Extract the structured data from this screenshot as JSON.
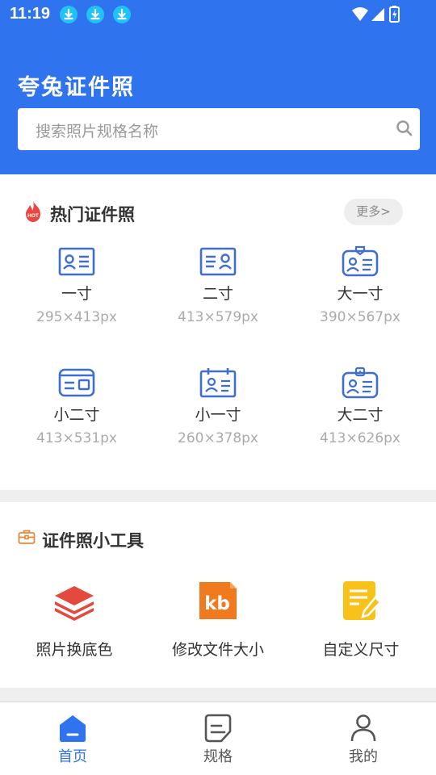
{
  "status_bar": {
    "time": "11:19"
  },
  "header": {
    "title": "夸兔证件照",
    "search_placeholder": "搜索照片规格名称"
  },
  "hot_section": {
    "badge": "HOT",
    "title": "热门证件照",
    "more_label": "更多>",
    "items": [
      {
        "name": "一寸",
        "size": "295×413px"
      },
      {
        "name": "二寸",
        "size": "413×579px"
      },
      {
        "name": "大一寸",
        "size": "390×567px"
      },
      {
        "name": "小二寸",
        "size": "413×531px"
      },
      {
        "name": "小一寸",
        "size": "260×378px"
      },
      {
        "name": "大二寸",
        "size": "413×626px"
      }
    ]
  },
  "tools_section": {
    "title": "证件照小工具",
    "items": [
      {
        "name": "照片换底色",
        "icon": "layers-icon",
        "color": "#e5493e"
      },
      {
        "name": "修改文件大小",
        "icon": "kb-icon",
        "label": "kb",
        "color": "#f27a1e"
      },
      {
        "name": "自定义尺寸",
        "icon": "edit-doc-icon",
        "color": "#f8c21b"
      }
    ]
  },
  "tabbar": {
    "tabs": [
      {
        "label": "首页",
        "icon": "home-icon",
        "active": true
      },
      {
        "label": "规格",
        "icon": "spec-icon",
        "active": false
      },
      {
        "label": "我的",
        "icon": "user-icon",
        "active": false
      }
    ]
  },
  "colors": {
    "primary": "#2f74ee",
    "icon_blue": "#3e6fd0",
    "inactive": "#555555"
  }
}
